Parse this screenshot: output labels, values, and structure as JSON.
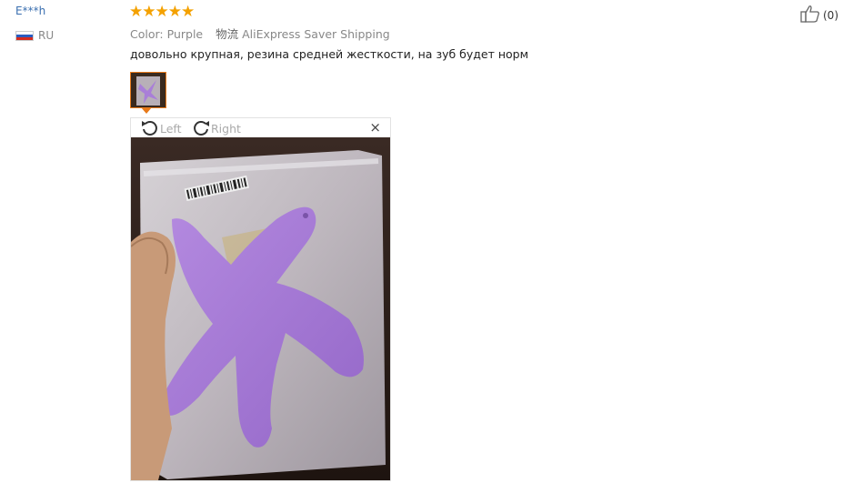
{
  "review": {
    "user_name": "E***h",
    "country": "RU",
    "rating": "★★★★★",
    "color_label": "Color:",
    "color_value": "Purple",
    "shipping_label": "物流",
    "shipping_value": "AliExpress Saver Shipping",
    "text": "довольно крупная, резина средней жесткости, на зуб будет норм",
    "likes": "(0)"
  },
  "viewer": {
    "rotate_left": "Left",
    "rotate_right": "Right",
    "close": "×"
  },
  "colors": {
    "star": "#f4a100",
    "link": "#3a6fb0",
    "thumb_border": "#e87a1a",
    "starfish": "#a97fd8"
  }
}
